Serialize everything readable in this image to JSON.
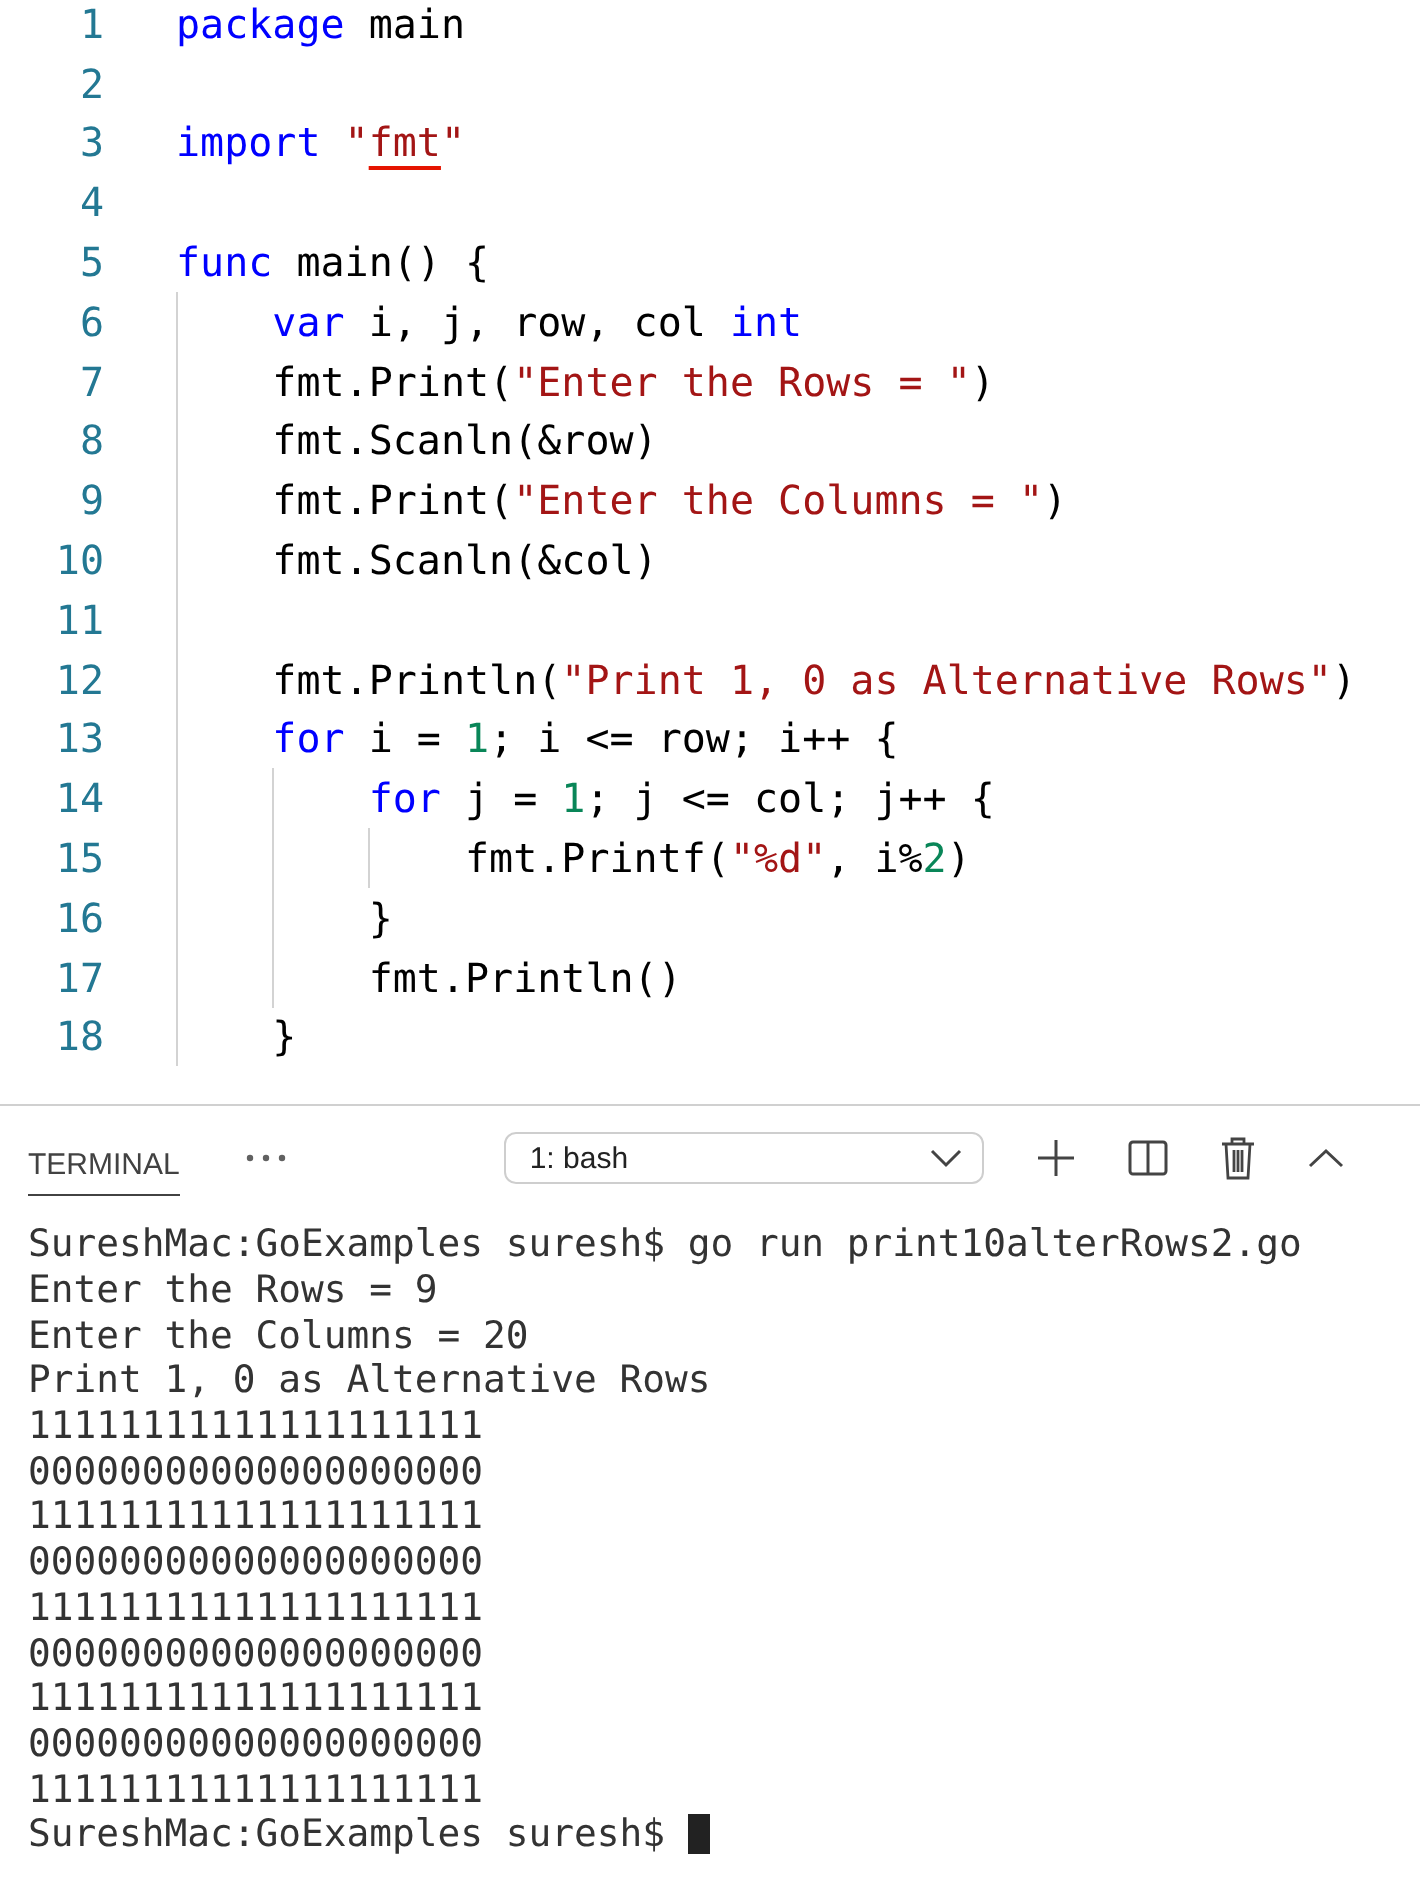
{
  "editor": {
    "lines": [
      {
        "number": "1",
        "tokens": [
          {
            "kind": "keyword",
            "text": "package"
          },
          {
            "kind": "plain",
            "text": " main"
          }
        ]
      },
      {
        "number": "2"
      },
      {
        "number": "3",
        "tokens": [
          {
            "kind": "keyword",
            "text": "import"
          },
          {
            "kind": "string",
            "text": " \""
          },
          {
            "kind": "error",
            "text": "fmt"
          },
          {
            "kind": "string",
            "text": "\""
          }
        ]
      },
      {
        "number": "4"
      },
      {
        "number": "5",
        "tokens": [
          {
            "kind": "keyword",
            "text": "func"
          },
          {
            "kind": "plain",
            "text": " main() {"
          }
        ]
      },
      {
        "number": "6",
        "tokens": [
          {
            "kind": "keyword",
            "text": "    var"
          },
          {
            "kind": "plain",
            "text": " i, j, row, col "
          },
          {
            "kind": "keyword",
            "text": "int"
          }
        ]
      },
      {
        "number": "7",
        "tokens": [
          {
            "kind": "plain",
            "text": "    fmt.Print("
          },
          {
            "kind": "string",
            "text": "\"Enter the Rows = \""
          },
          {
            "kind": "plain",
            "text": ")"
          }
        ]
      },
      {
        "number": "8",
        "tokens": [
          {
            "kind": "plain",
            "text": "    fmt.Scanln(&row)"
          }
        ]
      },
      {
        "number": "9",
        "tokens": [
          {
            "kind": "plain",
            "text": "    fmt.Print("
          },
          {
            "kind": "string",
            "text": "\"Enter the Columns = \""
          },
          {
            "kind": "plain",
            "text": ")"
          }
        ]
      },
      {
        "number": "10",
        "tokens": [
          {
            "kind": "plain",
            "text": "    fmt.Scanln(&col)"
          }
        ]
      },
      {
        "number": "11"
      },
      {
        "number": "12",
        "tokens": [
          {
            "kind": "plain",
            "text": "    fmt.Println("
          },
          {
            "kind": "string",
            "text": "\"Print 1, 0 as Alternative Rows\""
          },
          {
            "kind": "plain",
            "text": ")"
          }
        ]
      },
      {
        "number": "13",
        "tokens": [
          {
            "kind": "keyword",
            "text": "    for"
          },
          {
            "kind": "plain",
            "text": " i = "
          },
          {
            "kind": "number",
            "text": "1"
          },
          {
            "kind": "plain",
            "text": "; i <= row; i++ {"
          }
        ]
      },
      {
        "number": "14",
        "tokens": [
          {
            "kind": "keyword",
            "text": "        for"
          },
          {
            "kind": "plain",
            "text": " j = "
          },
          {
            "kind": "number",
            "text": "1"
          },
          {
            "kind": "plain",
            "text": "; j <= col; j++ {"
          }
        ]
      },
      {
        "number": "15",
        "tokens": [
          {
            "kind": "plain",
            "text": "            fmt.Printf("
          },
          {
            "kind": "string",
            "text": "\"%d\""
          },
          {
            "kind": "plain",
            "text": ", i%"
          },
          {
            "kind": "number",
            "text": "2"
          },
          {
            "kind": "plain",
            "text": ")"
          }
        ]
      },
      {
        "number": "16",
        "tokens": [
          {
            "kind": "plain",
            "text": "        }"
          }
        ]
      },
      {
        "number": "17",
        "tokens": [
          {
            "kind": "plain",
            "text": "        fmt.Println()"
          }
        ]
      },
      {
        "number": "18",
        "tokens": [
          {
            "kind": "plain",
            "text": "    }"
          }
        ]
      }
    ]
  },
  "panel": {
    "tabs": [
      {
        "label": "TERMINAL",
        "selected": true
      }
    ],
    "terminal_select": {
      "value": "1: bash"
    },
    "terminal": {
      "lines": [
        "SureshMac:GoExamples suresh$ go run print10alterRows2.go",
        "Enter the Rows = 9",
        "Enter the Columns = 20",
        "Print 1, 0 as Alternative Rows",
        "11111111111111111111",
        "00000000000000000000",
        "11111111111111111111",
        "00000000000000000000",
        "11111111111111111111",
        "00000000000000000000",
        "11111111111111111111",
        "00000000000000000000",
        "11111111111111111111",
        "SureshMac:GoExamples suresh$ "
      ],
      "cursor": true
    }
  }
}
